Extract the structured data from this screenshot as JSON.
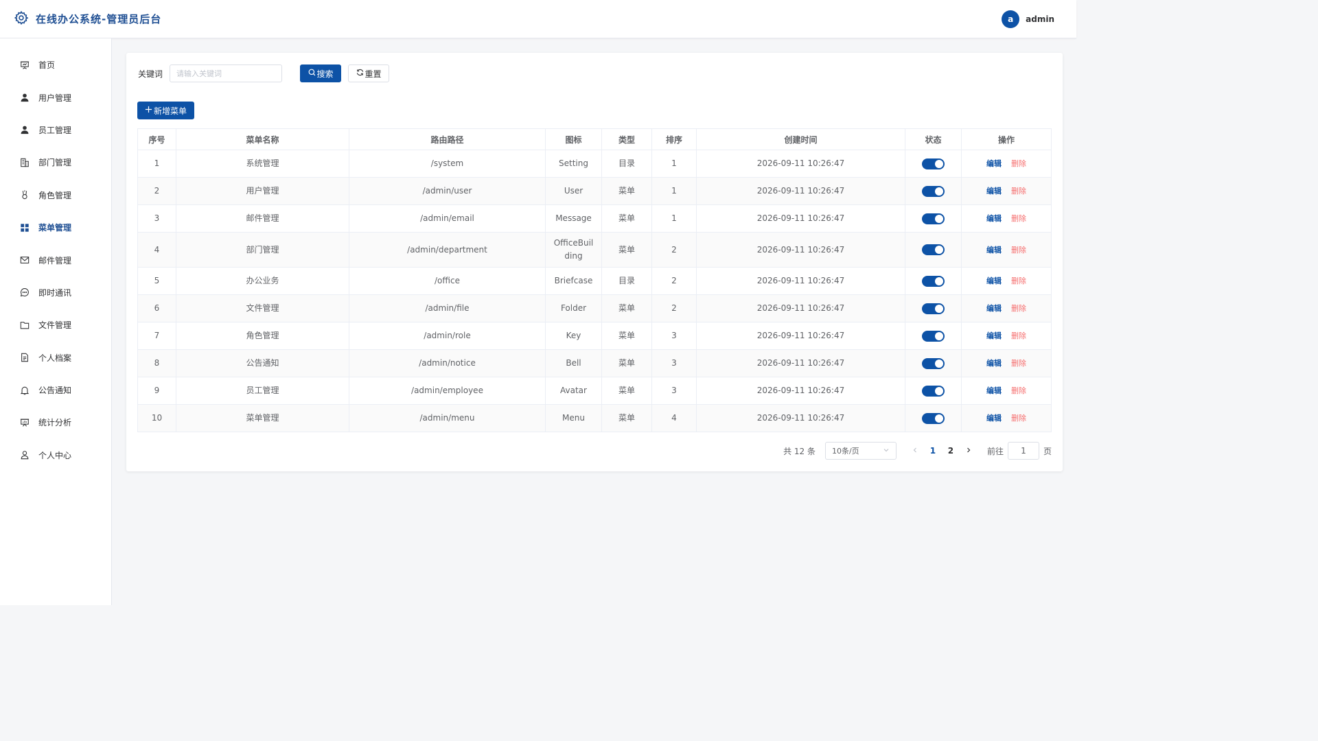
{
  "header": {
    "title": "在线办公系统-管理员后台",
    "avatar_letter": "a",
    "username": "admin",
    "brand_color": "#1f4f93"
  },
  "sidebar": {
    "items": [
      {
        "label": "首页",
        "icon": "presentation-icon"
      },
      {
        "label": "用户管理",
        "icon": "user-icon"
      },
      {
        "label": "员工管理",
        "icon": "user-icon"
      },
      {
        "label": "部门管理",
        "icon": "office-building-icon"
      },
      {
        "label": "角色管理",
        "icon": "medal-icon"
      },
      {
        "label": "菜单管理",
        "icon": "grid-menu-icon",
        "active": true
      },
      {
        "label": "邮件管理",
        "icon": "mail-icon"
      },
      {
        "label": "即时通讯",
        "icon": "chat-icon"
      },
      {
        "label": "文件管理",
        "icon": "folder-icon"
      },
      {
        "label": "个人档案",
        "icon": "document-icon"
      },
      {
        "label": "公告通知",
        "icon": "bell-icon"
      },
      {
        "label": "统计分析",
        "icon": "chart-board-icon"
      },
      {
        "label": "个人中心",
        "icon": "user-outline-icon"
      }
    ]
  },
  "search": {
    "label": "关键词",
    "placeholder": "请输入关键词",
    "value": "",
    "search_label": "搜索",
    "reset_label": "重置"
  },
  "toolbar": {
    "add_label": "新增菜单"
  },
  "table": {
    "columns": [
      "序号",
      "菜单名称",
      "路由路径",
      "图标",
      "类型",
      "排序",
      "创建时间",
      "状态",
      "操作"
    ],
    "edit_label": "编辑",
    "delete_label": "删除",
    "rows": [
      {
        "no": "1",
        "name": "系统管理",
        "path": "/system",
        "icon": "Setting",
        "type": "目录",
        "sort": "1",
        "created": "2026-09-11 10:26:47",
        "enabled": true
      },
      {
        "no": "2",
        "name": "用户管理",
        "path": "/admin/user",
        "icon": "User",
        "type": "菜单",
        "sort": "1",
        "created": "2026-09-11 10:26:47",
        "enabled": true
      },
      {
        "no": "3",
        "name": "邮件管理",
        "path": "/admin/email",
        "icon": "Message",
        "type": "菜单",
        "sort": "1",
        "created": "2026-09-11 10:26:47",
        "enabled": true
      },
      {
        "no": "4",
        "name": "部门管理",
        "path": "/admin/department",
        "icon": "OfficeBuilding",
        "type": "菜单",
        "sort": "2",
        "created": "2026-09-11 10:26:47",
        "enabled": true
      },
      {
        "no": "5",
        "name": "办公业务",
        "path": "/office",
        "icon": "Briefcase",
        "type": "目录",
        "sort": "2",
        "created": "2026-09-11 10:26:47",
        "enabled": true
      },
      {
        "no": "6",
        "name": "文件管理",
        "path": "/admin/file",
        "icon": "Folder",
        "type": "菜单",
        "sort": "2",
        "created": "2026-09-11 10:26:47",
        "enabled": true
      },
      {
        "no": "7",
        "name": "角色管理",
        "path": "/admin/role",
        "icon": "Key",
        "type": "菜单",
        "sort": "3",
        "created": "2026-09-11 10:26:47",
        "enabled": true
      },
      {
        "no": "8",
        "name": "公告通知",
        "path": "/admin/notice",
        "icon": "Bell",
        "type": "菜单",
        "sort": "3",
        "created": "2026-09-11 10:26:47",
        "enabled": true
      },
      {
        "no": "9",
        "name": "员工管理",
        "path": "/admin/employee",
        "icon": "Avatar",
        "type": "菜单",
        "sort": "3",
        "created": "2026-09-11 10:26:47",
        "enabled": true
      },
      {
        "no": "10",
        "name": "菜单管理",
        "path": "/admin/menu",
        "icon": "Menu",
        "type": "菜单",
        "sort": "4",
        "created": "2026-09-11 10:26:47",
        "enabled": true
      }
    ]
  },
  "pagination": {
    "total_text": "共 12 条",
    "page_size": "10条/页",
    "pages": [
      "1",
      "2"
    ],
    "current": "1",
    "goto_label": "前往",
    "goto_value": "1",
    "page_suffix": "页"
  },
  "colors": {
    "primary": "#0d52a6",
    "danger": "#f56c6c"
  }
}
